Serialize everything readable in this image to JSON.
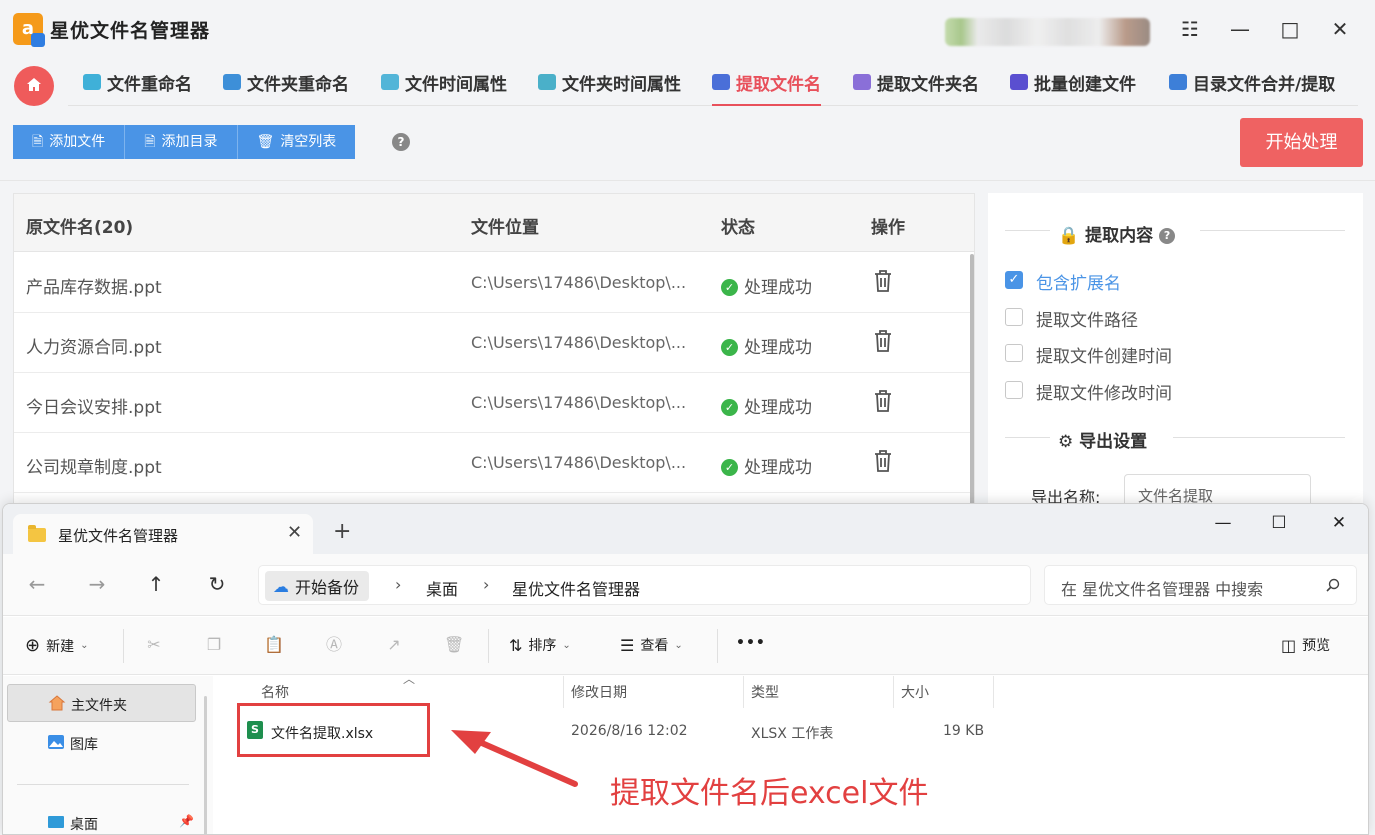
{
  "app": {
    "title": "星优文件名管理器",
    "logo_letter": "a",
    "window_controls": {
      "settings": "☷",
      "minimize": "—",
      "maximize": "□",
      "close": "✕"
    },
    "tabs": [
      {
        "label": "文件重命名",
        "active": false,
        "icon_color": "#3fb0d8"
      },
      {
        "label": "文件夹重命名",
        "active": false,
        "icon_color": "#3d8fd8"
      },
      {
        "label": "文件时间属性",
        "active": false,
        "icon_color": "#53b5d8"
      },
      {
        "label": "文件夹时间属性",
        "active": false,
        "icon_color": "#4ab0c9"
      },
      {
        "label": "提取文件名",
        "active": true,
        "icon_color": "#4a6fd8"
      },
      {
        "label": "提取文件夹名",
        "active": false,
        "icon_color": "#8a6fd8"
      },
      {
        "label": "批量创建文件",
        "active": false,
        "icon_color": "#5a4fd0"
      },
      {
        "label": "目录文件合并/提取",
        "active": false,
        "icon_color": "#3d7fd8"
      }
    ],
    "toolbar": {
      "add_file": "添加文件",
      "add_dir": "添加目录",
      "clear_list": "清空列表",
      "help": "?"
    },
    "start_button": "开始处理",
    "table": {
      "headers": {
        "name": "原文件名(20)",
        "location": "文件位置",
        "status": "状态",
        "action": "操作"
      },
      "rows": [
        {
          "name": "产品库存数据.ppt",
          "location": "C:\\Users\\17486\\Desktop\\...",
          "status": "处理成功"
        },
        {
          "name": "人力资源合同.ppt",
          "location": "C:\\Users\\17486\\Desktop\\...",
          "status": "处理成功"
        },
        {
          "name": "今日会议安排.ppt",
          "location": "C:\\Users\\17486\\Desktop\\...",
          "status": "处理成功"
        },
        {
          "name": "公司规章制度.ppt",
          "location": "C:\\Users\\17486\\Desktop\\...",
          "status": "处理成功"
        }
      ]
    },
    "side": {
      "extract_title": "提取内容",
      "options": [
        {
          "label": "包含扩展名",
          "checked": true
        },
        {
          "label": "提取文件路径",
          "checked": false
        },
        {
          "label": "提取文件创建时间",
          "checked": false
        },
        {
          "label": "提取文件修改时间",
          "checked": false
        }
      ],
      "export_title": "导出设置",
      "export_name_label": "导出名称:",
      "export_name_value": "文件名提取"
    }
  },
  "explorer": {
    "tab_title": "星优文件名管理器",
    "breadcrumb": [
      "开始备份",
      "桌面",
      "星优文件名管理器"
    ],
    "search_placeholder": "在 星优文件名管理器 中搜索",
    "commands": {
      "new": "新建",
      "sort": "排序",
      "view": "查看",
      "more": "•••",
      "preview": "预览"
    },
    "nav": [
      {
        "label": "主文件夹",
        "selected": true
      },
      {
        "label": "图库",
        "selected": false
      },
      {
        "label": "桌面",
        "selected": false
      }
    ],
    "columns": {
      "name": "名称",
      "modified": "修改日期",
      "type": "类型",
      "size": "大小"
    },
    "files": [
      {
        "name": "文件名提取.xlsx",
        "modified": "2026/8/16 12:02",
        "type": "XLSX 工作表",
        "size": "19 KB"
      }
    ]
  },
  "annotation": {
    "text": "提取文件名后excel文件",
    "color": "#e24040"
  }
}
